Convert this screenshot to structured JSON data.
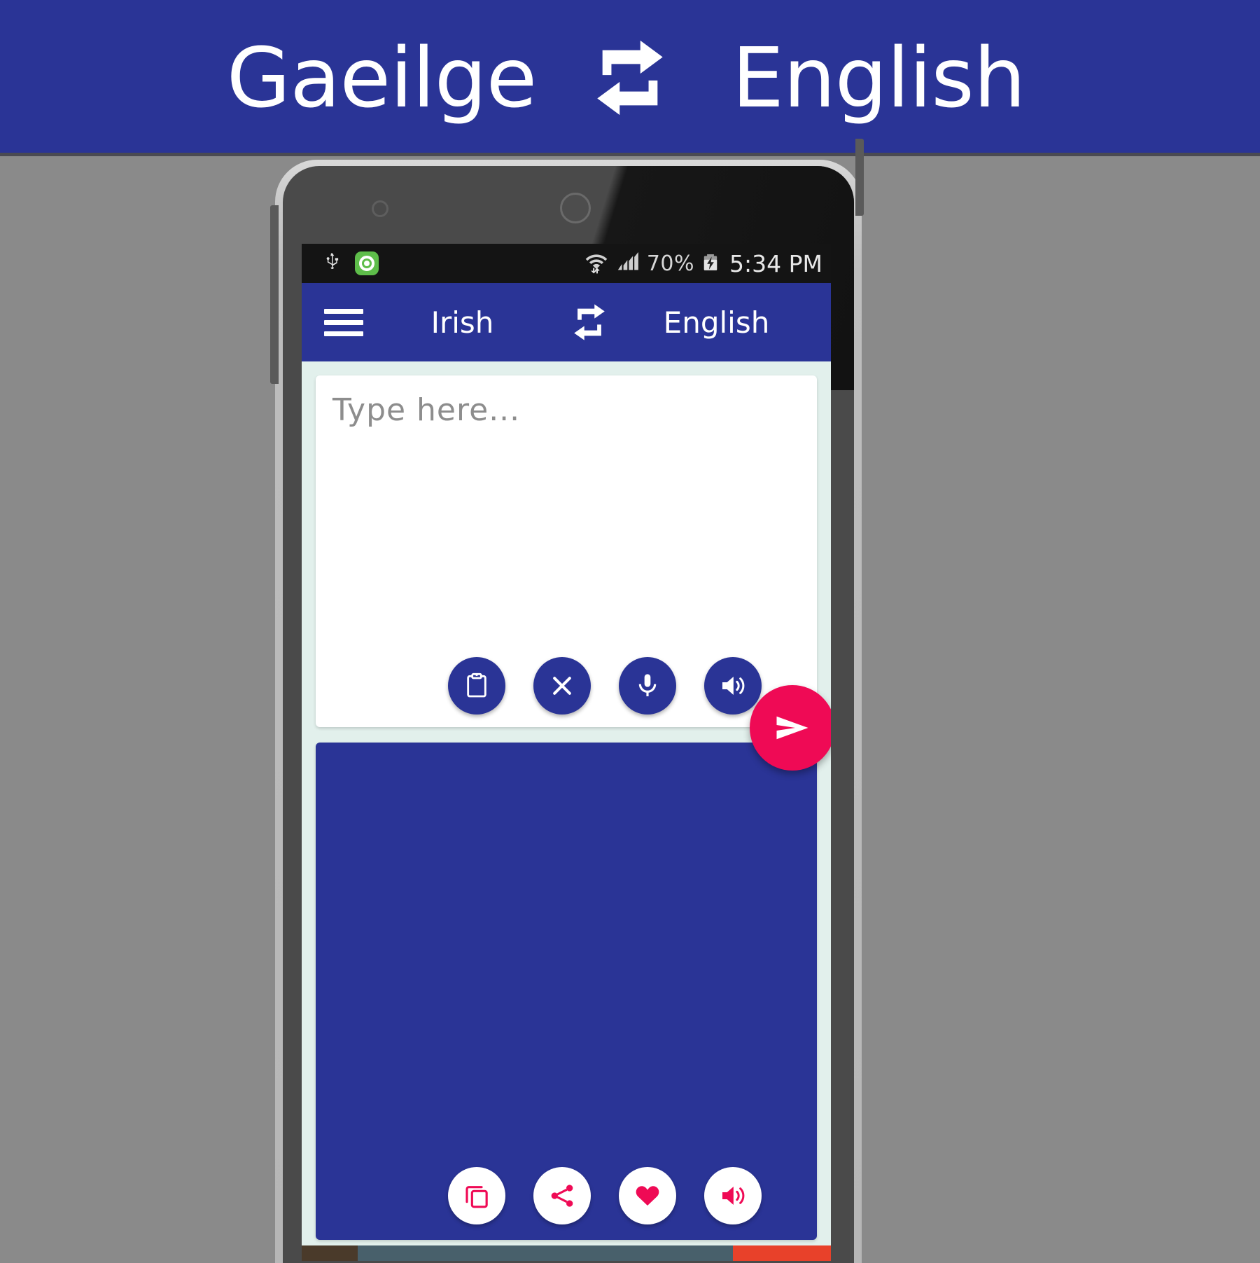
{
  "promo_banner": {
    "source_language": "Gaeilge",
    "target_language": "English",
    "swap_icon": "swap-repeat-icon",
    "background_color": "#2a3496",
    "text_color": "#ffffff"
  },
  "phone": {
    "status_bar": {
      "usb_icon": "usb-icon",
      "app_notification_icon": "green-target-app-icon",
      "wifi_icon": "wifi-icon",
      "signal_icon": "cellular-signal-icon",
      "battery_percent": "70%",
      "battery_icon": "battery-charging-icon",
      "clock": "5:34 PM",
      "background_color": "#141414"
    },
    "toolbar": {
      "menu_icon": "hamburger-menu-icon",
      "source_language": "Irish",
      "swap_icon": "swap-repeat-icon",
      "target_language": "English",
      "background_color": "#2a3496"
    },
    "input_card": {
      "placeholder": "Type here...",
      "value": "",
      "background_color": "#ffffff",
      "actions": [
        {
          "name": "paste-button",
          "icon": "clipboard-icon",
          "label": "Paste"
        },
        {
          "name": "clear-button",
          "icon": "close-x-icon",
          "label": "Clear"
        },
        {
          "name": "voice-input-button",
          "icon": "microphone-icon",
          "label": "Speak"
        },
        {
          "name": "speak-source-button",
          "icon": "speaker-volume-icon",
          "label": "Listen"
        }
      ]
    },
    "send_button": {
      "icon": "send-paper-plane-icon",
      "label": "Translate",
      "color": "#ef0a55"
    },
    "output_card": {
      "text": "",
      "background_color": "#2a3496",
      "actions": [
        {
          "name": "copy-button",
          "icon": "copy-icon",
          "label": "Copy"
        },
        {
          "name": "share-button",
          "icon": "share-icon",
          "label": "Share"
        },
        {
          "name": "favorite-button",
          "icon": "heart-icon",
          "label": "Favorite"
        },
        {
          "name": "speak-result-button",
          "icon": "speaker-volume-icon",
          "label": "Listen"
        }
      ],
      "accent_color": "#ef0a55"
    },
    "ad_banner": {
      "visible": true,
      "background_color": "#48606b",
      "cta_color": "#e8412a"
    },
    "screen_background_color": "#e2f0ec"
  }
}
